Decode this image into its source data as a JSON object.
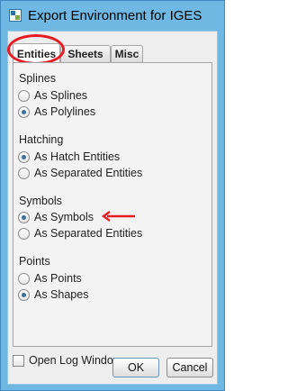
{
  "window": {
    "title": "Export Environment for IGES"
  },
  "tabs": [
    {
      "label": "Entities",
      "active": true
    },
    {
      "label": "Sheets",
      "active": false
    },
    {
      "label": "Misc",
      "active": false
    }
  ],
  "groups": {
    "splines": {
      "label": "Splines",
      "options": [
        {
          "label": "As Splines",
          "checked": false
        },
        {
          "label": "As Polylines",
          "checked": true
        }
      ]
    },
    "hatching": {
      "label": "Hatching",
      "options": [
        {
          "label": "As Hatch Entities",
          "checked": true
        },
        {
          "label": "As Separated Entities",
          "checked": false
        }
      ]
    },
    "symbols": {
      "label": "Symbols",
      "options": [
        {
          "label": "As Symbols",
          "checked": true
        },
        {
          "label": "As Separated Entities",
          "checked": false
        }
      ]
    },
    "points": {
      "label": "Points",
      "options": [
        {
          "label": "As Points",
          "checked": false
        },
        {
          "label": "As Shapes",
          "checked": true
        }
      ]
    }
  },
  "log_window": {
    "label": "Open Log Window",
    "checked": false
  },
  "buttons": {
    "ok": "OK",
    "cancel": "Cancel"
  },
  "colors": {
    "title_bar": "#6fb8e4",
    "annotation": "#e51c23",
    "radio_dot": "#3d6e99"
  },
  "icons": {
    "app": "app-icon",
    "arrow": "red-arrow-icon"
  }
}
